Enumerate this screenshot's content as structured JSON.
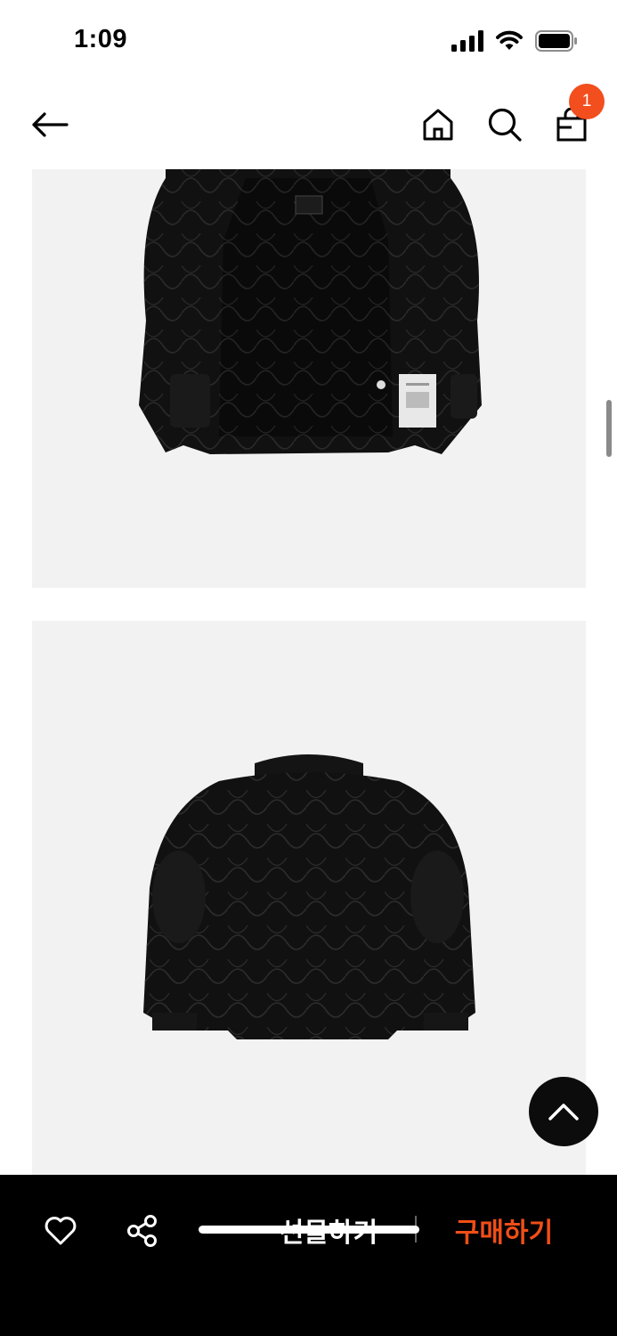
{
  "status_bar": {
    "time": "1:09"
  },
  "header": {
    "back_icon": "arrow-left-icon",
    "home_icon": "home-icon",
    "search_icon": "search-icon",
    "cart_icon": "shopping-bag-icon",
    "cart_count": "1"
  },
  "gallery": {
    "images": [
      {
        "description": "black quilted liner jacket, open front view"
      },
      {
        "description": "black quilted liner jacket, back view"
      }
    ]
  },
  "scroll_top_icon": "chevron-up-icon",
  "action_bar": {
    "wish_icon": "heart-icon",
    "share_icon": "share-icon",
    "gift_label": "선물하기",
    "buy_label": "구매하기"
  },
  "colors": {
    "accent": "#f24e1e",
    "buy_text": "#f04e17",
    "action_bar_bg": "#000000",
    "image_bg": "#f2f2f2"
  }
}
